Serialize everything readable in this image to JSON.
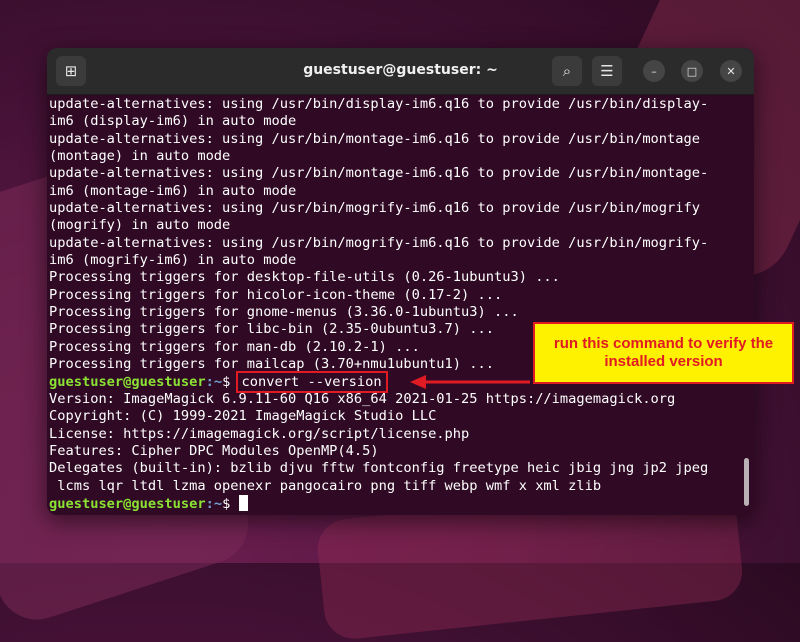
{
  "window": {
    "title": "guestuser@guestuser: ~",
    "buttons": {
      "new_tab_icon": "⊞",
      "search_icon": "⌕",
      "menu_icon": "☰",
      "minimize_icon": "–",
      "maximize_icon": "□",
      "close_icon": "✕"
    }
  },
  "terminal": {
    "output_lines": [
      "update-alternatives: using /usr/bin/display-im6.q16 to provide /usr/bin/display-",
      "im6 (display-im6) in auto mode",
      "update-alternatives: using /usr/bin/montage-im6.q16 to provide /usr/bin/montage",
      "(montage) in auto mode",
      "update-alternatives: using /usr/bin/montage-im6.q16 to provide /usr/bin/montage-",
      "im6 (montage-im6) in auto mode",
      "update-alternatives: using /usr/bin/mogrify-im6.q16 to provide /usr/bin/mogrify",
      "(mogrify) in auto mode",
      "update-alternatives: using /usr/bin/mogrify-im6.q16 to provide /usr/bin/mogrify-",
      "im6 (mogrify-im6) in auto mode",
      "Processing triggers for desktop-file-utils (0.26-1ubuntu3) ...",
      "Processing triggers for hicolor-icon-theme (0.17-2) ...",
      "Processing triggers for gnome-menus (3.36.0-1ubuntu3) ...",
      "Processing triggers for libc-bin (2.35-0ubuntu3.7) ...",
      "Processing triggers for man-db (2.10.2-1) ...",
      "Processing triggers for mailcap (3.70+nmu1ubuntu1) ..."
    ],
    "prompt_user": "guestuser@guestuser",
    "prompt_path": ":~",
    "prompt_symbol": "$ ",
    "command": "convert --version",
    "result_lines": [
      "Version: ImageMagick 6.9.11-60 Q16 x86_64 2021-01-25 https://imagemagick.org",
      "Copyright: (C) 1999-2021 ImageMagick Studio LLC",
      "License: https://imagemagick.org/script/license.php",
      "Features: Cipher DPC Modules OpenMP(4.5)",
      "Delegates (built-in): bzlib djvu fftw fontconfig freetype heic jbig jng jp2 jpeg",
      " lcms lqr ltdl lzma openexr pangocairo png tiff webp wmf x xml zlib"
    ]
  },
  "annotation": {
    "callout_text": "run this command to verify the installed version",
    "color_border": "#e01b24",
    "color_fill": "#fff200"
  }
}
